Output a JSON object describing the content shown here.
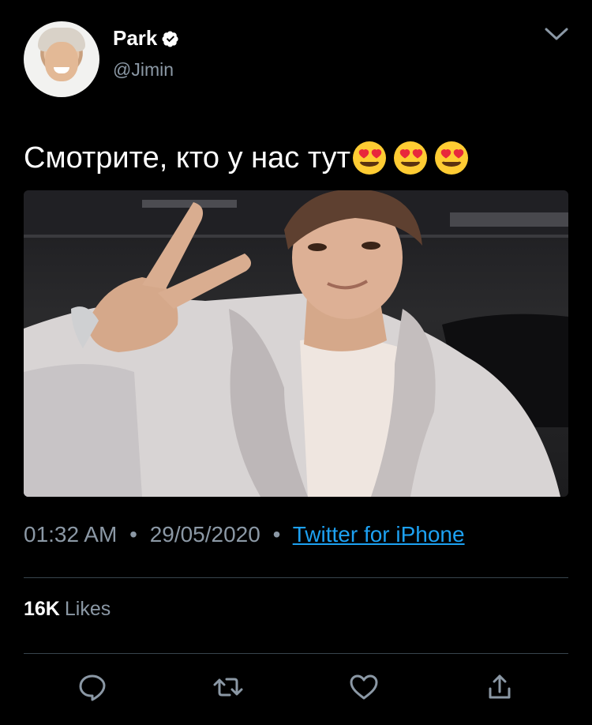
{
  "author": {
    "display_name": "Park",
    "handle": "@Jimin",
    "verified": true,
    "verified_icon": "verified-badge-icon"
  },
  "tweet": {
    "text": "Смотрите, кто у нас тут",
    "emojis": [
      "😍",
      "😍",
      "😍"
    ]
  },
  "meta": {
    "time": "01:32 AM",
    "separator": "•",
    "date": "29/05/2020",
    "source": "Twitter for iPhone"
  },
  "stats": {
    "likes_count": "16K",
    "likes_label": "Likes"
  },
  "actions": [
    {
      "name": "reply",
      "icon": "reply-icon"
    },
    {
      "name": "retweet",
      "icon": "retweet-icon"
    },
    {
      "name": "like",
      "icon": "heart-icon"
    },
    {
      "name": "share",
      "icon": "share-icon"
    }
  ],
  "colors": {
    "background": "#000000",
    "secondary_text": "#8b98a5",
    "link": "#1da1f2",
    "divider": "#38444d"
  }
}
